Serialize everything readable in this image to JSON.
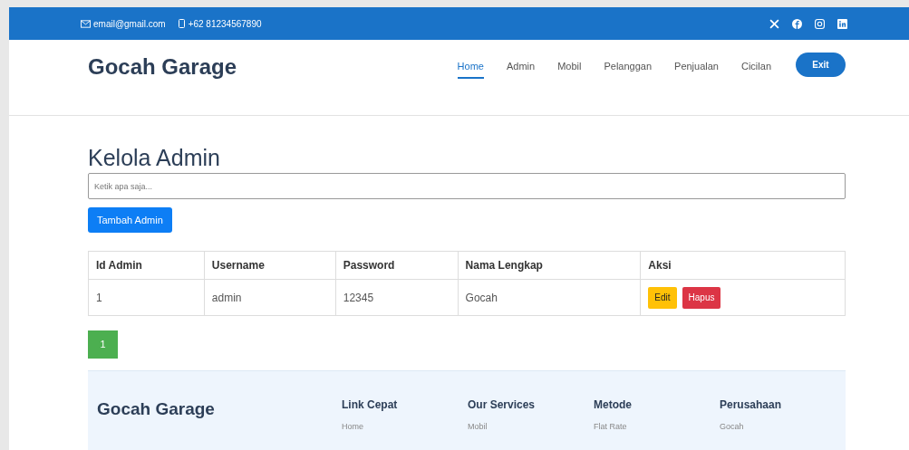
{
  "topbar": {
    "email": "email@gmail.com",
    "phone": "+62 81234567890"
  },
  "header": {
    "brand": "Gocah Garage",
    "nav": [
      {
        "label": "Home",
        "selected": true
      },
      {
        "label": "Admin",
        "selected": false
      },
      {
        "label": "Mobil",
        "selected": false
      },
      {
        "label": "Pelanggan",
        "selected": false
      },
      {
        "label": "Penjualan",
        "selected": false
      },
      {
        "label": "Cicilan",
        "selected": false
      }
    ],
    "exit_button": "Exit"
  },
  "main": {
    "title": "Kelola Admin",
    "search": {
      "placeholder": "Ketik apa saja..."
    },
    "add_button": "Tambah Admin",
    "table": {
      "columns": [
        "Id Admin",
        "Username",
        "Password",
        "Nama Lengkap",
        "Aksi"
      ],
      "rows": [
        {
          "cells": [
            "1",
            "admin",
            "12345",
            "Gocah"
          ],
          "actions": [
            {
              "label": "Edit",
              "kind": "edit"
            },
            {
              "label": "Hapus",
              "kind": "delete"
            }
          ]
        }
      ]
    },
    "pagination": [
      {
        "label": "1",
        "selected": true
      }
    ]
  },
  "footer": {
    "brand": "Gocah Garage",
    "columns": [
      {
        "heading": "Link Cepat",
        "links": [
          "Home"
        ]
      },
      {
        "heading": "Our Services",
        "links": [
          "Mobil"
        ]
      },
      {
        "heading": "Metode",
        "links": [
          "Flat Rate"
        ]
      },
      {
        "heading": "Perusahaan",
        "links": [
          "Gocah"
        ]
      }
    ]
  }
}
